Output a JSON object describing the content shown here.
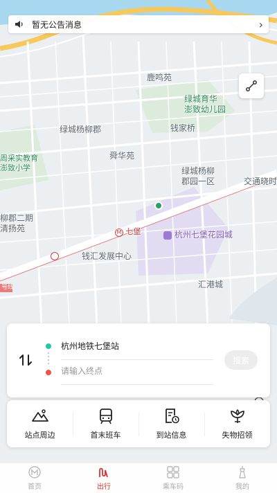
{
  "status_bar": {
    "time": "",
    "battery": ""
  },
  "notice": {
    "text": "暂无公告消息"
  },
  "map": {
    "labels": {
      "luming": "鹿鸣苑",
      "kindergarten": "绿城育华\n澎致幼儿园",
      "qianjiaqiao": "钱家桥",
      "yangliujun": "绿城杨柳郡",
      "shuanghua": "舜华苑",
      "school": "周采实教育\n澎致小学",
      "yangliujun_1": "绿城杨柳\n郡园一区",
      "jiaotong": "交通晓时",
      "yangliujun_2": "柳郡二期\n清扬苑",
      "qibao": "七堡",
      "mall": "杭州七堡花园城",
      "qiuhui": "钱汇发展中心",
      "huigang": "汇港城",
      "line_tag": "号线",
      "metro_mark": "M"
    }
  },
  "search": {
    "from": "杭州地铁七堡站",
    "to_placeholder": "请输入终点",
    "search_label": "搜索"
  },
  "actions": [
    {
      "label": "站点周边",
      "icon": "mountain-icon"
    },
    {
      "label": "首末班车",
      "icon": "bus-icon"
    },
    {
      "label": "到站信息",
      "icon": "clock-doc-icon"
    },
    {
      "label": "失物招领",
      "icon": "flower-icon"
    }
  ],
  "tabs": [
    {
      "label": "首页",
      "icon": "metro-logo-icon",
      "active": false
    },
    {
      "label": "出行",
      "icon": "route-icon",
      "active": true
    },
    {
      "label": "乘车码",
      "icon": "qr-grid-icon",
      "active": false
    },
    {
      "label": "我的",
      "icon": "tower-icon",
      "active": false
    }
  ],
  "colors": {
    "accent": "#d9322c",
    "start_dot": "#26c6a6",
    "end_dot": "#f0504a",
    "river": "#a8d8f0",
    "green_area": "#d8ecd8",
    "mall_area": "#e2dcf3",
    "metro_line": "#e97c7c",
    "road_major": "#f7c85a"
  }
}
